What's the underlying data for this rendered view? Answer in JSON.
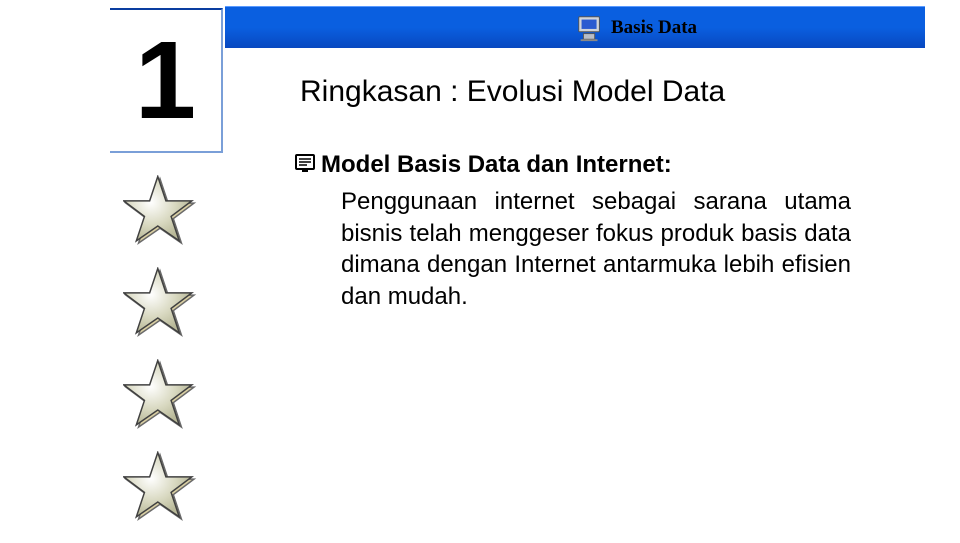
{
  "header": {
    "title": "Basis Data",
    "icon": "computer-icon"
  },
  "chapter": {
    "number": "1"
  },
  "slide": {
    "title": "Ringkasan : Evolusi Model Data"
  },
  "content": {
    "bullet_heading": "Model Basis Data dan Internet:",
    "body": "Penggunaan internet sebagai sarana utama bisnis telah menggeser fokus produk basis data dimana dengan Internet antarmuka lebih efisien dan mudah."
  }
}
